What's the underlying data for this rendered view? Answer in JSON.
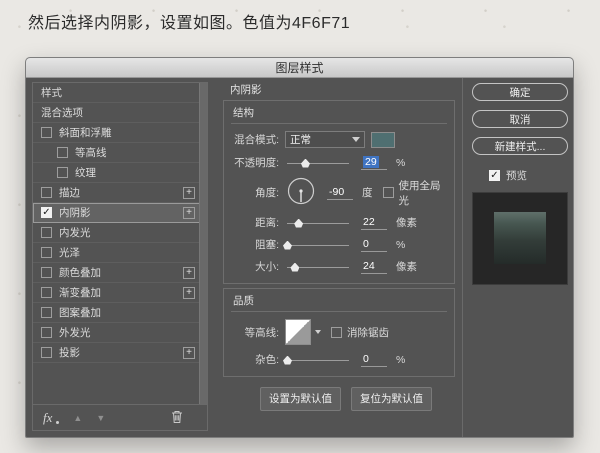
{
  "caption": "然后选择内阴影，设置如图。色值为4F6F71",
  "colors": {
    "shadow_color": "#4F6F71",
    "selection_blue": "#3f74c2"
  },
  "dialog": {
    "title": "图层样式",
    "sidebar": {
      "items": [
        {
          "label": "样式",
          "checkbox": false,
          "checked": false,
          "plus": false,
          "indent": false,
          "selected": false
        },
        {
          "label": "混合选项",
          "checkbox": false,
          "checked": false,
          "plus": false,
          "indent": false,
          "selected": false
        },
        {
          "label": "斜面和浮雕",
          "checkbox": true,
          "checked": false,
          "plus": false,
          "indent": false,
          "selected": false
        },
        {
          "label": "等高线",
          "checkbox": true,
          "checked": false,
          "plus": false,
          "indent": true,
          "selected": false
        },
        {
          "label": "纹理",
          "checkbox": true,
          "checked": false,
          "plus": false,
          "indent": true,
          "selected": false
        },
        {
          "label": "描边",
          "checkbox": true,
          "checked": false,
          "plus": true,
          "indent": false,
          "selected": false
        },
        {
          "label": "内阴影",
          "checkbox": true,
          "checked": true,
          "plus": true,
          "indent": false,
          "selected": true
        },
        {
          "label": "内发光",
          "checkbox": true,
          "checked": false,
          "plus": false,
          "indent": false,
          "selected": false
        },
        {
          "label": "光泽",
          "checkbox": true,
          "checked": false,
          "plus": false,
          "indent": false,
          "selected": false
        },
        {
          "label": "颜色叠加",
          "checkbox": true,
          "checked": false,
          "plus": true,
          "indent": false,
          "selected": false
        },
        {
          "label": "渐变叠加",
          "checkbox": true,
          "checked": false,
          "plus": true,
          "indent": false,
          "selected": false
        },
        {
          "label": "图案叠加",
          "checkbox": true,
          "checked": false,
          "plus": false,
          "indent": false,
          "selected": false
        },
        {
          "label": "外发光",
          "checkbox": true,
          "checked": false,
          "plus": false,
          "indent": false,
          "selected": false
        },
        {
          "label": "投影",
          "checkbox": true,
          "checked": false,
          "plus": true,
          "indent": false,
          "selected": false
        }
      ],
      "footer": {
        "fx": "fx"
      }
    },
    "panel": {
      "title": "内阴影",
      "structure": {
        "label": "结构",
        "blend": {
          "label": "混合模式:",
          "value": "正常"
        },
        "opacity": {
          "label": "不透明度:",
          "value": "29",
          "unit": "%",
          "selected": true,
          "slider_pct": 29
        },
        "angle": {
          "label": "角度:",
          "value": "-90",
          "unit": "度",
          "global_light": "使用全局光",
          "global_light_checked": false
        },
        "distance": {
          "label": "距离:",
          "value": "22",
          "unit": "像素",
          "slider_pct": 18
        },
        "choke": {
          "label": "阻塞:",
          "value": "0",
          "unit": "%",
          "slider_pct": 0
        },
        "size": {
          "label": "大小:",
          "value": "24",
          "unit": "像素",
          "slider_pct": 12
        }
      },
      "quality": {
        "label": "品质",
        "contour": {
          "label": "等高线:",
          "anti_alias": "消除锯齿",
          "anti_alias_checked": false
        },
        "noise": {
          "label": "杂色:",
          "value": "0",
          "unit": "%",
          "slider_pct": 0
        }
      },
      "buttons": {
        "make_default": "设置为默认值",
        "reset_default": "复位为默认值"
      }
    },
    "actions": {
      "ok": "确定",
      "cancel": "取消",
      "new_style": "新建样式...",
      "preview": "预览",
      "preview_checked": true
    }
  }
}
